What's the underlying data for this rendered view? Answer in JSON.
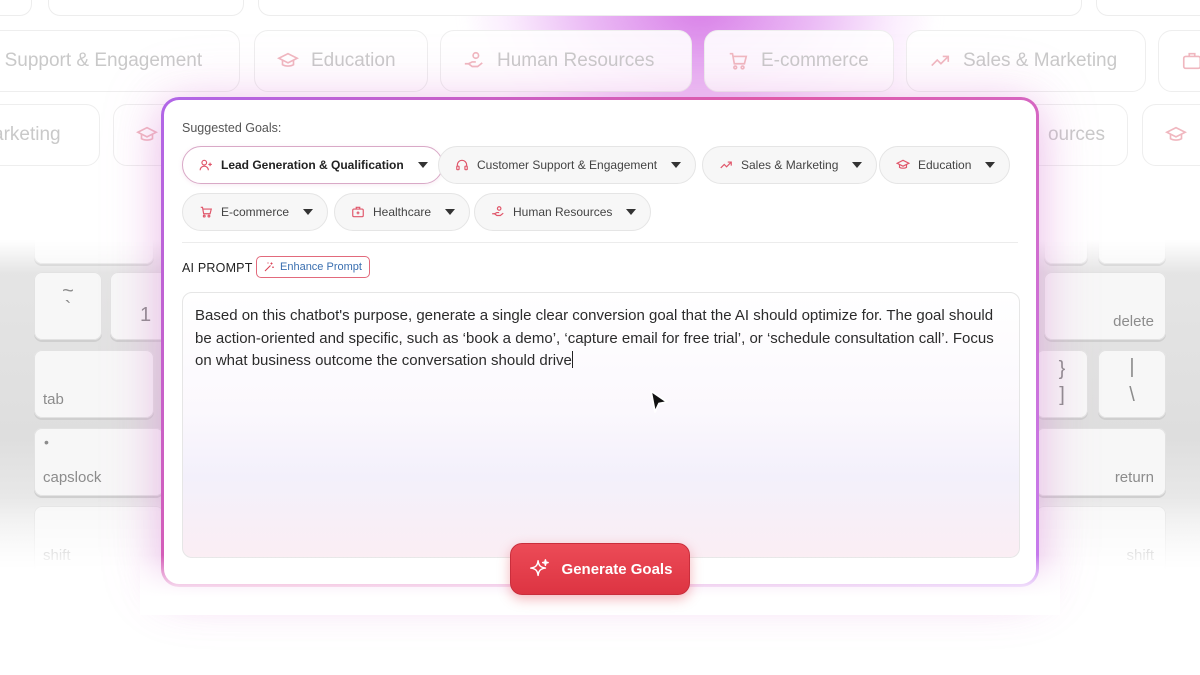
{
  "background": {
    "top_chips": [
      {
        "label": "r Support & Engagement",
        "icon": "headset-icon"
      },
      {
        "label": "Education",
        "icon": "graduation-cap-icon"
      },
      {
        "label": "Human Resources",
        "icon": "hand-coins-icon"
      },
      {
        "label": "E-commerce",
        "icon": "cart-icon"
      },
      {
        "label": "Sales & Marketing",
        "icon": "trend-up-icon"
      }
    ],
    "row2_chips": [
      {
        "label": "arketing"
      },
      {
        "label": "ources"
      }
    ],
    "keys": {
      "tilde": "~",
      "backtick": "`",
      "one": "1",
      "tab": "tab",
      "capslock": "capslock",
      "shift_left": "shift",
      "delete": "delete",
      "return": "return",
      "shift_right": "shift",
      "brace_open": "}",
      "bracket_close": "]",
      "pipe": "|",
      "backslash": "\\"
    }
  },
  "panel": {
    "suggested_label": "Suggested Goals:",
    "goals": [
      {
        "label": "Lead Generation & Qualification",
        "icon": "user-plus-icon",
        "active": true
      },
      {
        "label": "Customer Support & Engagement",
        "icon": "headset-icon",
        "active": false
      },
      {
        "label": "Sales & Marketing",
        "icon": "trend-up-icon",
        "active": false
      },
      {
        "label": "Education",
        "icon": "graduation-cap-icon",
        "active": false
      },
      {
        "label": "E-commerce",
        "icon": "cart-icon",
        "active": false
      },
      {
        "label": "Healthcare",
        "icon": "medical-kit-icon",
        "active": false
      },
      {
        "label": "Human Resources",
        "icon": "hand-coins-icon",
        "active": false
      }
    ],
    "ai_prompt_label": "AI PROMPT",
    "enhance_label": "Enhance Prompt",
    "prompt_text": "Based on this chatbot's purpose, generate a single clear conversion goal that the AI should optimize for. The goal should be action-oriented and specific, such as ‘book a demo’, ‘capture email for free trial’, or ‘schedule consultation call’. Focus on what business outcome the conversation should drive",
    "generate_label": "Generate Goals"
  },
  "colors": {
    "accent_red": "#dd3442",
    "icon_red": "#e0566a",
    "frame_purple": "#b066e8",
    "frame_pink": "#e05aa8"
  }
}
